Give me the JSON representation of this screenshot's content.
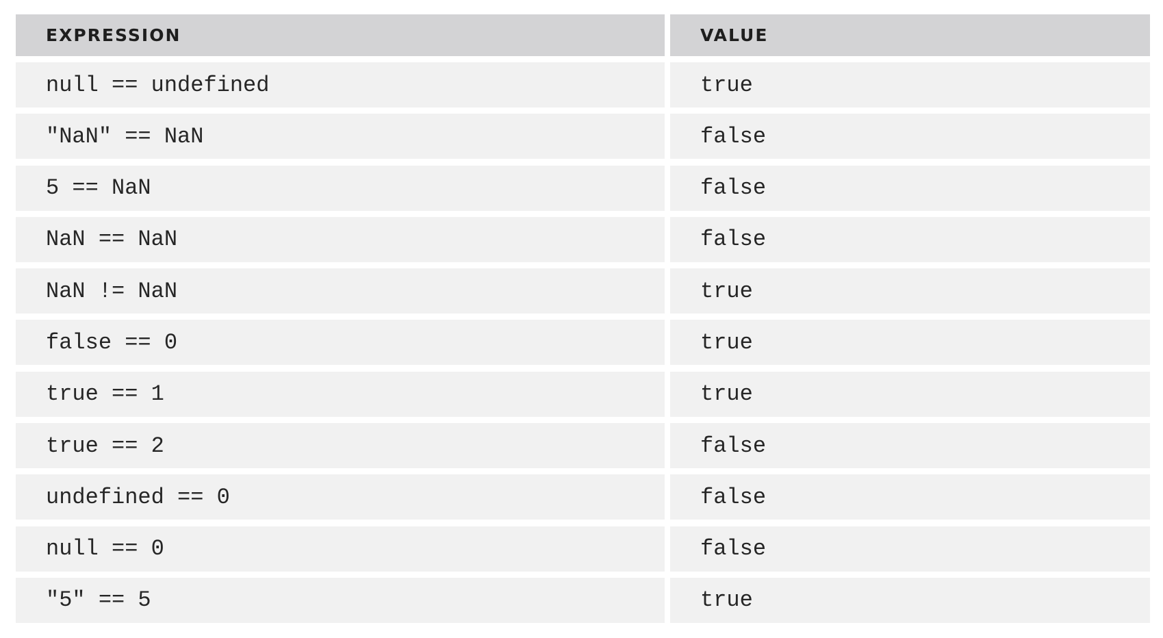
{
  "table": {
    "headers": [
      "EXPRESSION",
      "VALUE"
    ],
    "rows": [
      {
        "expression": "null == undefined",
        "value": "true"
      },
      {
        "expression": "\"NaN\" == NaN",
        "value": "false"
      },
      {
        "expression": "5 == NaN",
        "value": "false"
      },
      {
        "expression": "NaN == NaN",
        "value": "false"
      },
      {
        "expression": "NaN != NaN",
        "value": "true"
      },
      {
        "expression": "false == 0",
        "value": "true"
      },
      {
        "expression": "true == 1",
        "value": "true"
      },
      {
        "expression": "true == 2",
        "value": "false"
      },
      {
        "expression": "undefined == 0",
        "value": "false"
      },
      {
        "expression": "null == 0",
        "value": "false"
      },
      {
        "expression": "\"5\" == 5",
        "value": "true"
      }
    ]
  }
}
